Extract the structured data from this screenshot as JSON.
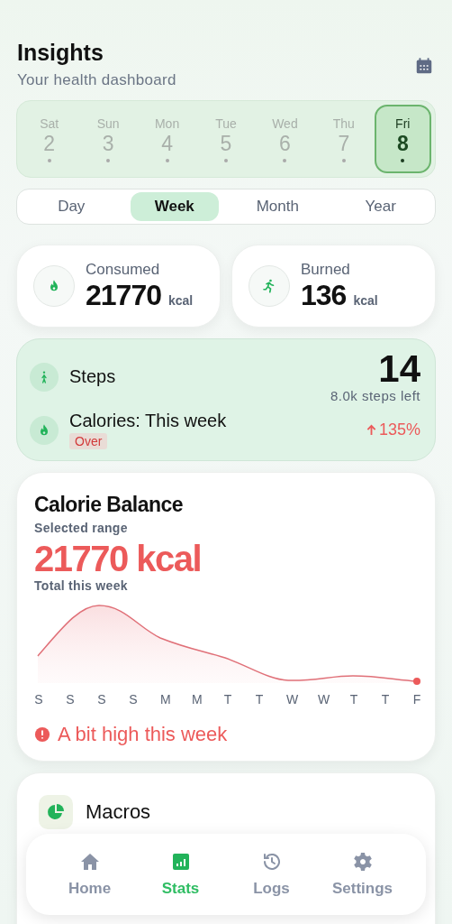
{
  "header": {
    "title": "Insights",
    "subtitle": "Your health dashboard"
  },
  "days": [
    {
      "weekday": "Sat",
      "date": "2",
      "selected": false
    },
    {
      "weekday": "Sun",
      "date": "3",
      "selected": false
    },
    {
      "weekday": "Mon",
      "date": "4",
      "selected": false
    },
    {
      "weekday": "Tue",
      "date": "5",
      "selected": false
    },
    {
      "weekday": "Wed",
      "date": "6",
      "selected": false
    },
    {
      "weekday": "Thu",
      "date": "7",
      "selected": false
    },
    {
      "weekday": "Fri",
      "date": "8",
      "selected": true
    }
  ],
  "ranges": [
    {
      "label": "Day",
      "selected": false
    },
    {
      "label": "Week",
      "selected": true
    },
    {
      "label": "Month",
      "selected": false
    },
    {
      "label": "Year",
      "selected": false
    }
  ],
  "summary": [
    {
      "kind": "flame",
      "label": "Consumed",
      "value": "21770",
      "unit": "kcal"
    },
    {
      "kind": "runner",
      "label": "Burned",
      "value": "136",
      "unit": "kcal"
    }
  ],
  "goals": {
    "steps": {
      "label": "Steps",
      "value": "14",
      "note": "8.0k steps left"
    },
    "calories": {
      "label": "Calories: This week",
      "badge": "Over",
      "change": "135%"
    }
  },
  "balance": {
    "title": "Calorie Balance",
    "subtitle": "Selected range",
    "total": "21770 kcal",
    "caption": "Total this week",
    "x_labels": [
      "S",
      "S",
      "S",
      "S",
      "M",
      "M",
      "T",
      "T",
      "W",
      "W",
      "T",
      "T",
      "F"
    ],
    "alert": "A bit high this week"
  },
  "macros": {
    "title": "Macros"
  },
  "nav": [
    {
      "kind": "home",
      "label": "Home",
      "selected": false
    },
    {
      "kind": "stats",
      "label": "Stats",
      "selected": true
    },
    {
      "kind": "logs",
      "label": "Logs",
      "selected": false
    },
    {
      "kind": "settings",
      "label": "Settings",
      "selected": false
    }
  ]
}
